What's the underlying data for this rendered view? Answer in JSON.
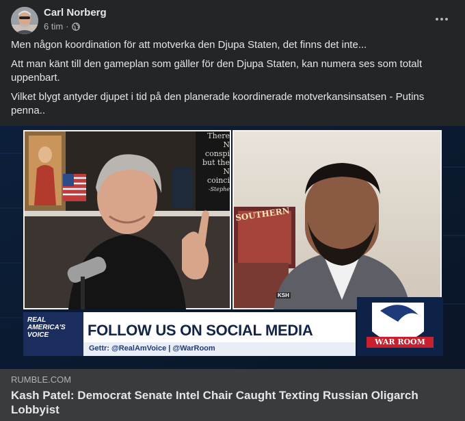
{
  "post": {
    "author": "Carl Norberg",
    "time": "6 tim",
    "separator": "·",
    "privacy_icon": "globe-icon",
    "menu_icon": "more-horizontal-icon",
    "paragraphs": [
      "Men någon koordination för att motverka den Djupa Staten, det finns det inte...",
      "Att man känt till den gameplan som gäller för den Djupa Staten, kan numera ses som totalt uppenbart.",
      "Vilket blygt antyder djupet i tid på den planerade koordinerade motverkansinsatsen - Putins penna.."
    ]
  },
  "video": {
    "book_text": [
      "There",
      "N",
      "conspi",
      "but the",
      "N",
      "coinci",
      "-Stephe"
    ],
    "poster_text": "SOUTHERN",
    "pin_text": "KSH",
    "brand_line1": "REAL",
    "brand_line2": "AMERICA'S",
    "brand_line3": "VOICE",
    "banner_title": "FOLLOW US ON SOCIAL MEDIA",
    "banner_handles": "Gettr: @RealAmVoice | @WarRoom",
    "warroom_label": "WAR ROOM"
  },
  "link_preview": {
    "domain": "RUMBLE.COM",
    "title": "Kash Patel: Democrat Senate Intel Chair Caught Texting Russian Oligarch Lobbyist"
  },
  "colors": {
    "card_bg": "#242526",
    "link_bg": "#3a3b3c",
    "banner_blue": "#1d3a7a",
    "brand_red": "#c8202f"
  }
}
